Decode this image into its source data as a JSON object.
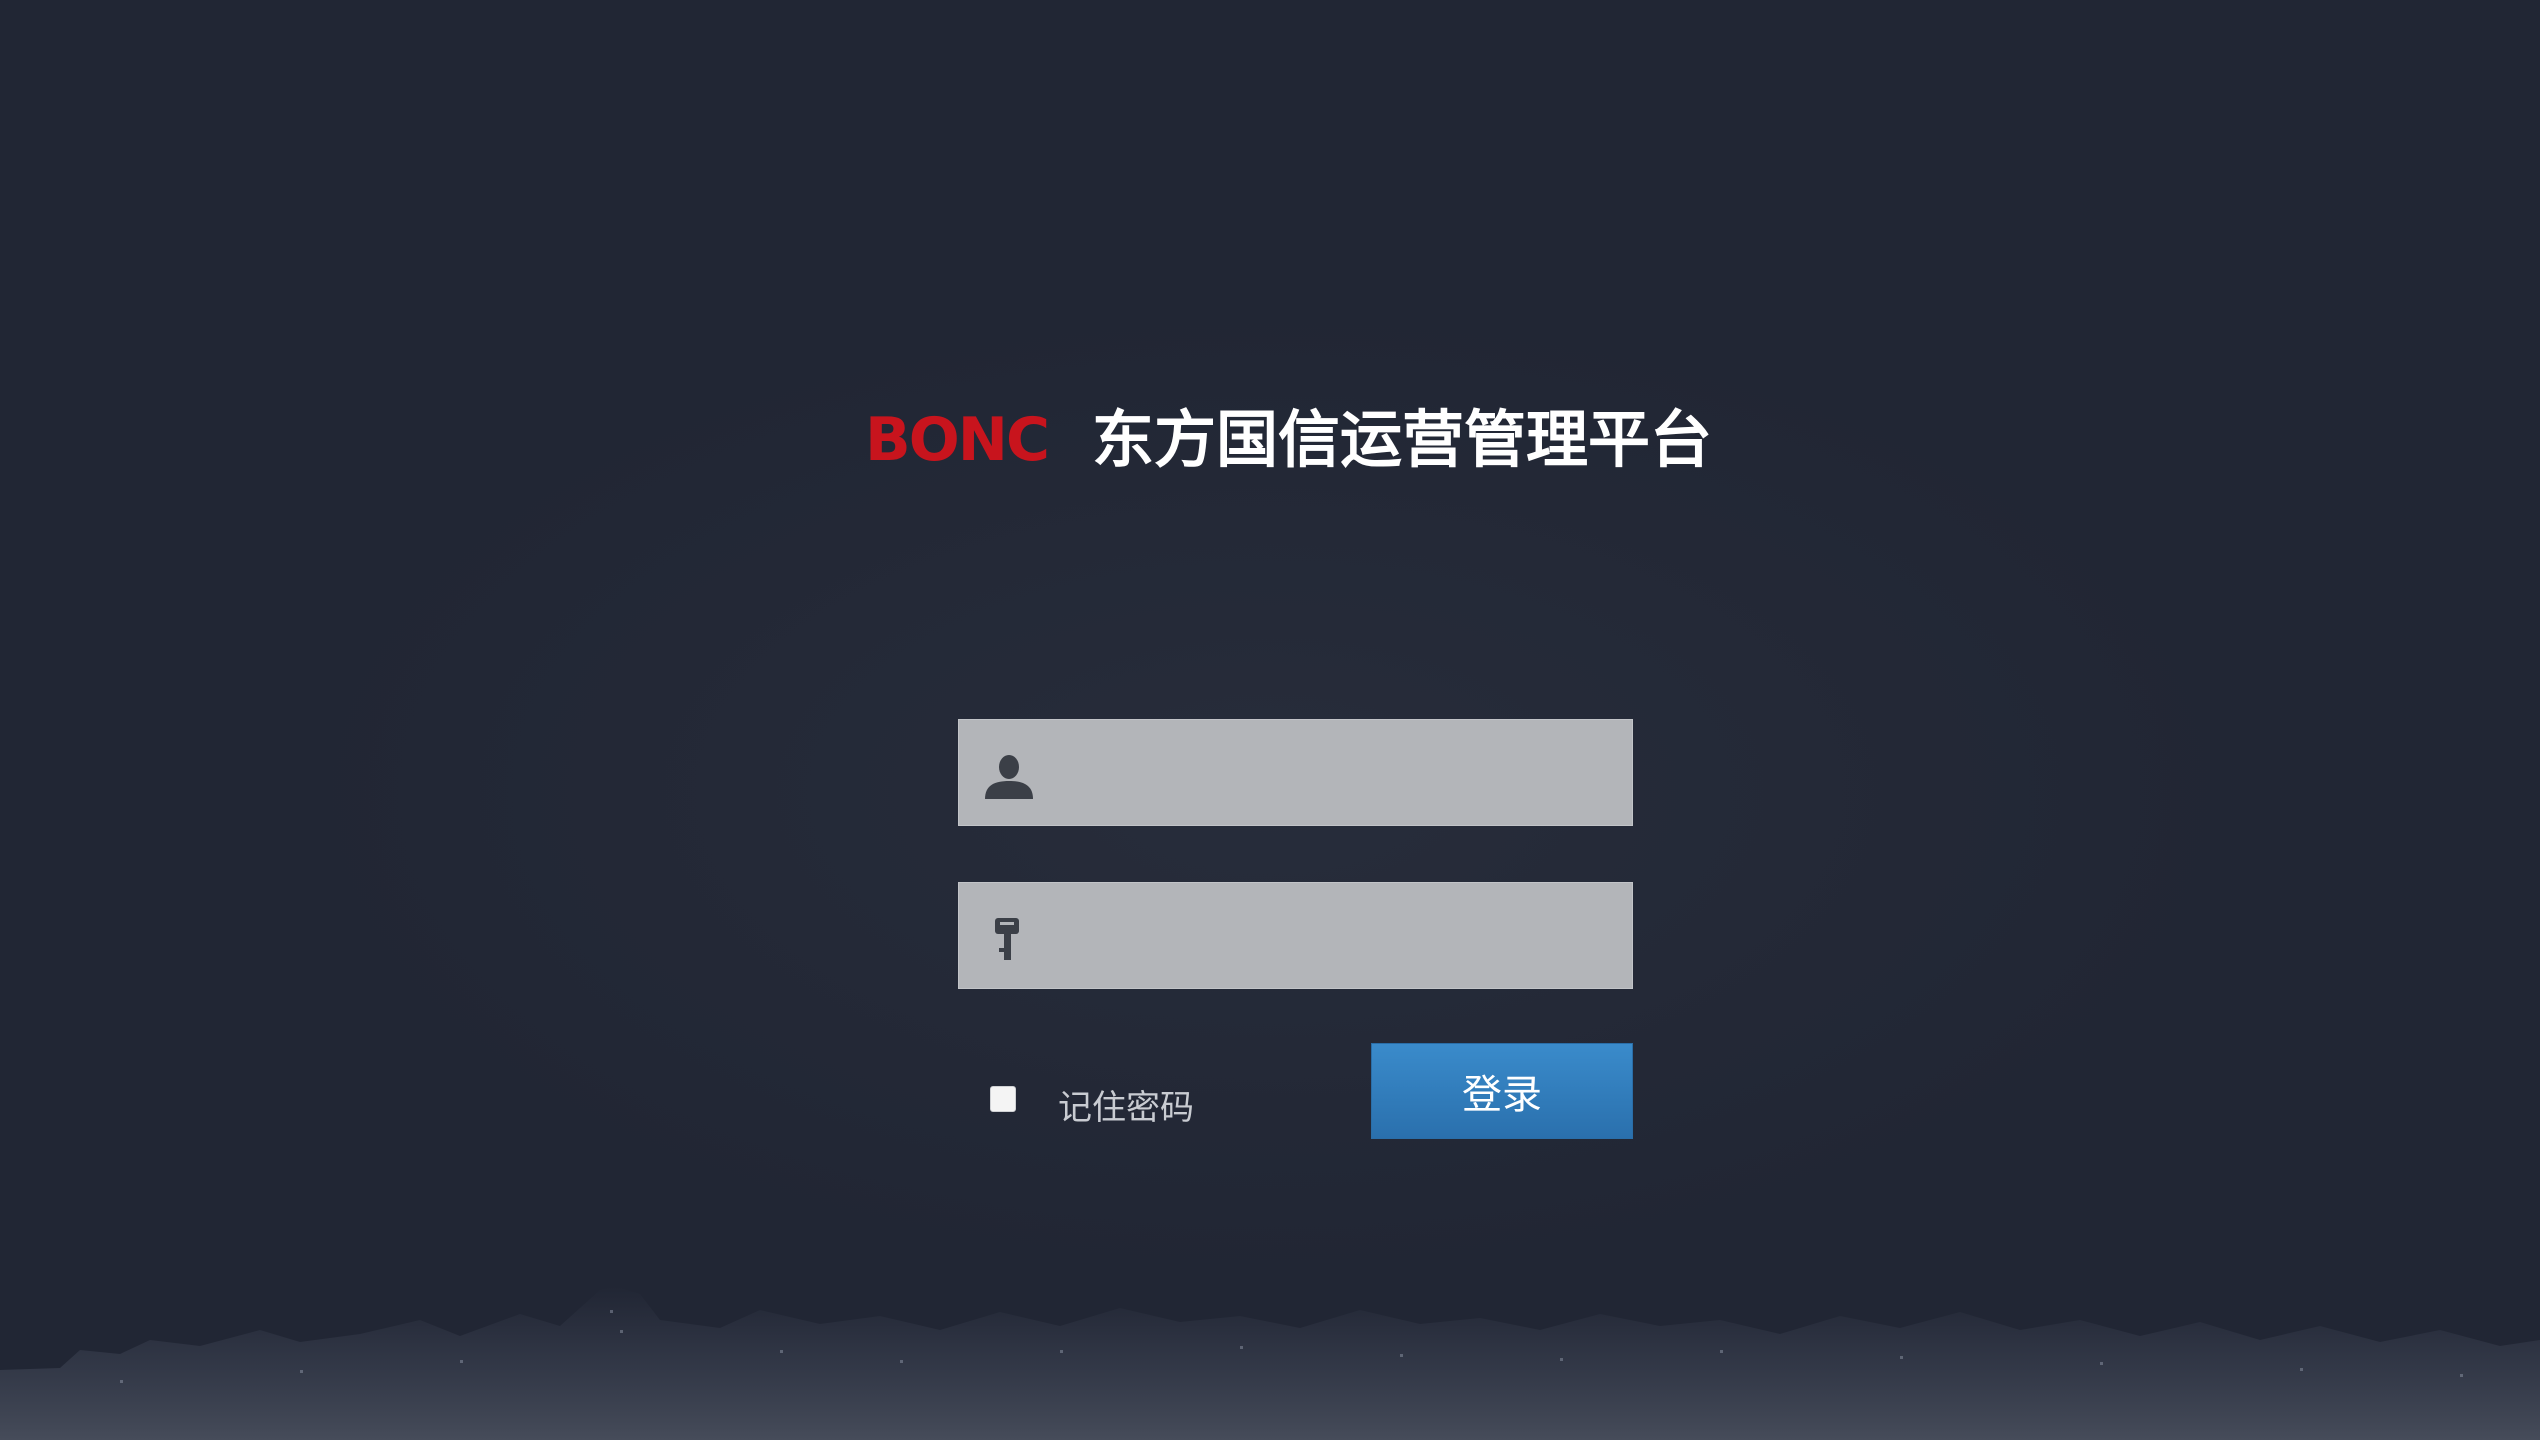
{
  "header": {
    "logo_text": "BONC",
    "title": "东方国信运营管理平台"
  },
  "login_form": {
    "username": {
      "icon": "user-icon",
      "value": "",
      "placeholder": ""
    },
    "password": {
      "icon": "key-icon",
      "value": "",
      "placeholder": ""
    },
    "remember": {
      "label": "记住密码",
      "checked": false
    },
    "submit_label": "登录"
  },
  "colors": {
    "background": "#212634",
    "logo": "#c8141d",
    "title": "#ffffff",
    "field_bg": "#b3b5b9",
    "button": "#3182c0"
  }
}
